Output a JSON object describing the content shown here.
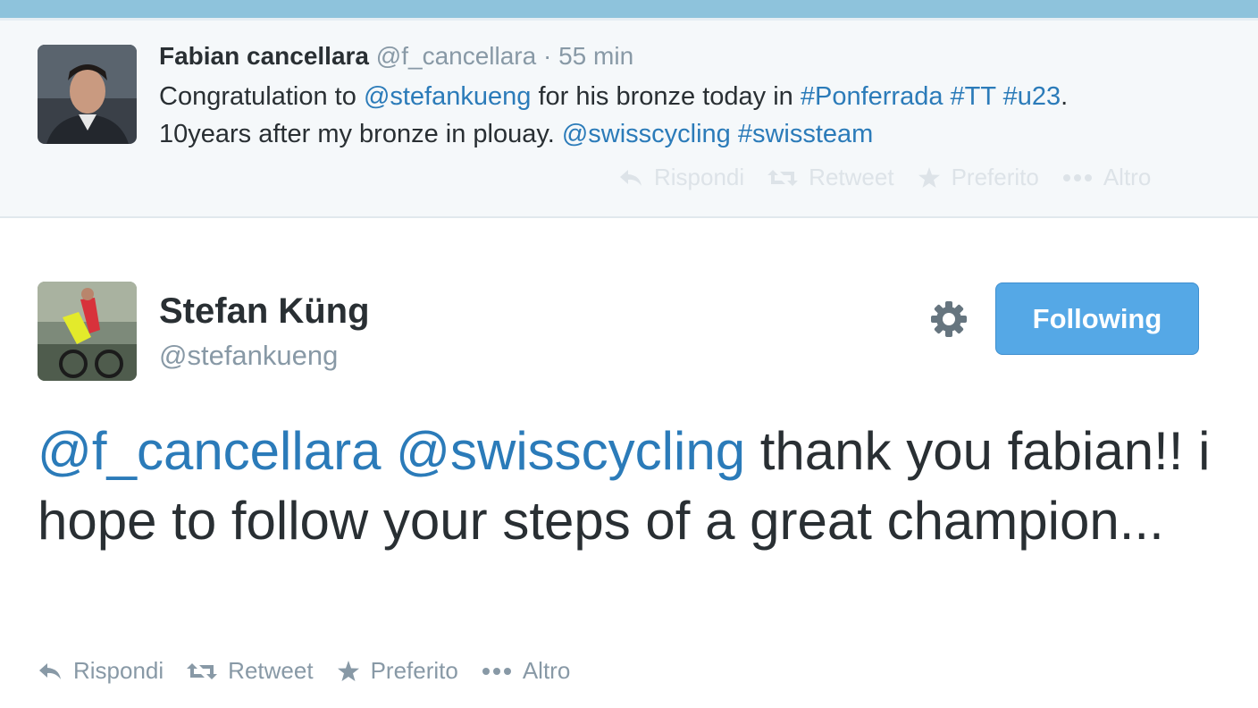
{
  "colors": {
    "link": "#2b7bb9",
    "follow_button": "#55a8e6",
    "top_bar": "#8ec3dc"
  },
  "parent_tweet": {
    "name": "Fabian cancellara",
    "handle": "@f_cancellara",
    "separator": "·",
    "time": "55 min",
    "text": {
      "t1": "Congratulation to ",
      "mention1": "@stefankueng",
      "t2": " for his bronze today in ",
      "hashtag1": "#Ponferrada",
      "hashtag2": "#TT",
      "hashtag3": "#u23",
      "t3": ".",
      "t4": "10years after my bronze in plouay. ",
      "mention2": "@swisscycling",
      "hashtag4": "#swissteam"
    },
    "actions": {
      "reply": "Rispondi",
      "retweet": "Retweet",
      "favorite": "Preferito",
      "more": "Altro"
    }
  },
  "main_tweet": {
    "name": "Stefan Küng",
    "handle": "@stefankueng",
    "follow_label": "Following",
    "text": {
      "mention1": "@f_cancellara",
      "mention2": "@swisscycling",
      "body": " thank you fabian!! i hope to follow your steps of a great champion..."
    },
    "actions": {
      "reply": "Rispondi",
      "retweet": "Retweet",
      "favorite": "Preferito",
      "more": "Altro"
    }
  },
  "icons": {
    "reply": "reply-icon",
    "retweet": "retweet-icon",
    "favorite": "star-icon",
    "more": "more-icon",
    "settings": "gear-icon"
  }
}
